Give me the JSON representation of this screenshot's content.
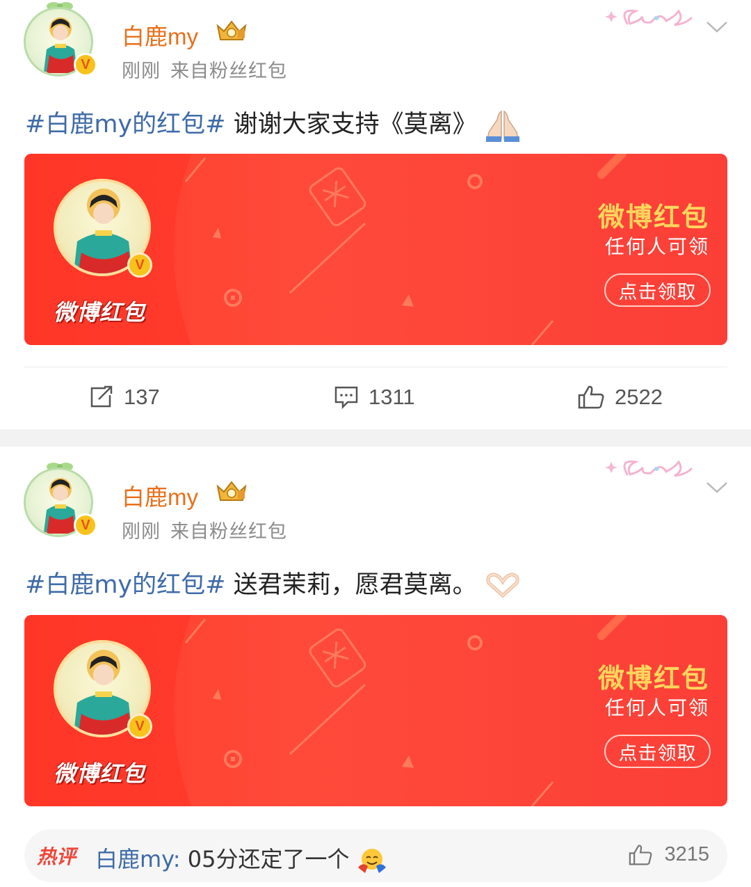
{
  "posts": [
    {
      "author": "白鹿my",
      "time": "刚刚",
      "source": "来自粉丝红包",
      "hashtag": "#白鹿my的红包#",
      "text": " 谢谢大家支持《莫离》",
      "emoji": "folded-hands",
      "card": {
        "logo": "微博红包",
        "title": "微博红包",
        "subtitle": "任何人可领",
        "button": "点击领取"
      },
      "actions": {
        "reposts": "137",
        "comments": "1311",
        "likes": "2522"
      }
    },
    {
      "author": "白鹿my",
      "time": "刚刚",
      "source": "来自粉丝红包",
      "hashtag": "#白鹿my的红包#",
      "text": " 送君茉莉，愿君莫离。",
      "emoji": "heart-hands",
      "card": {
        "logo": "微博红包",
        "title": "微博红包",
        "subtitle": "任何人可领",
        "button": "点击领取"
      },
      "hot_comment": {
        "tag": "热评",
        "user": "白鹿my:",
        "text": " 05分还定了一个",
        "emoji": "hugging-face",
        "likes": "3215"
      }
    }
  ],
  "colors": {
    "username": "#e8701a",
    "hashtag": "#3f6ba7",
    "card_red": "#ff3d2a",
    "card_title": "#ffd65c",
    "verified_badge": "#f7c21b"
  },
  "badges": {
    "verified": "V"
  }
}
